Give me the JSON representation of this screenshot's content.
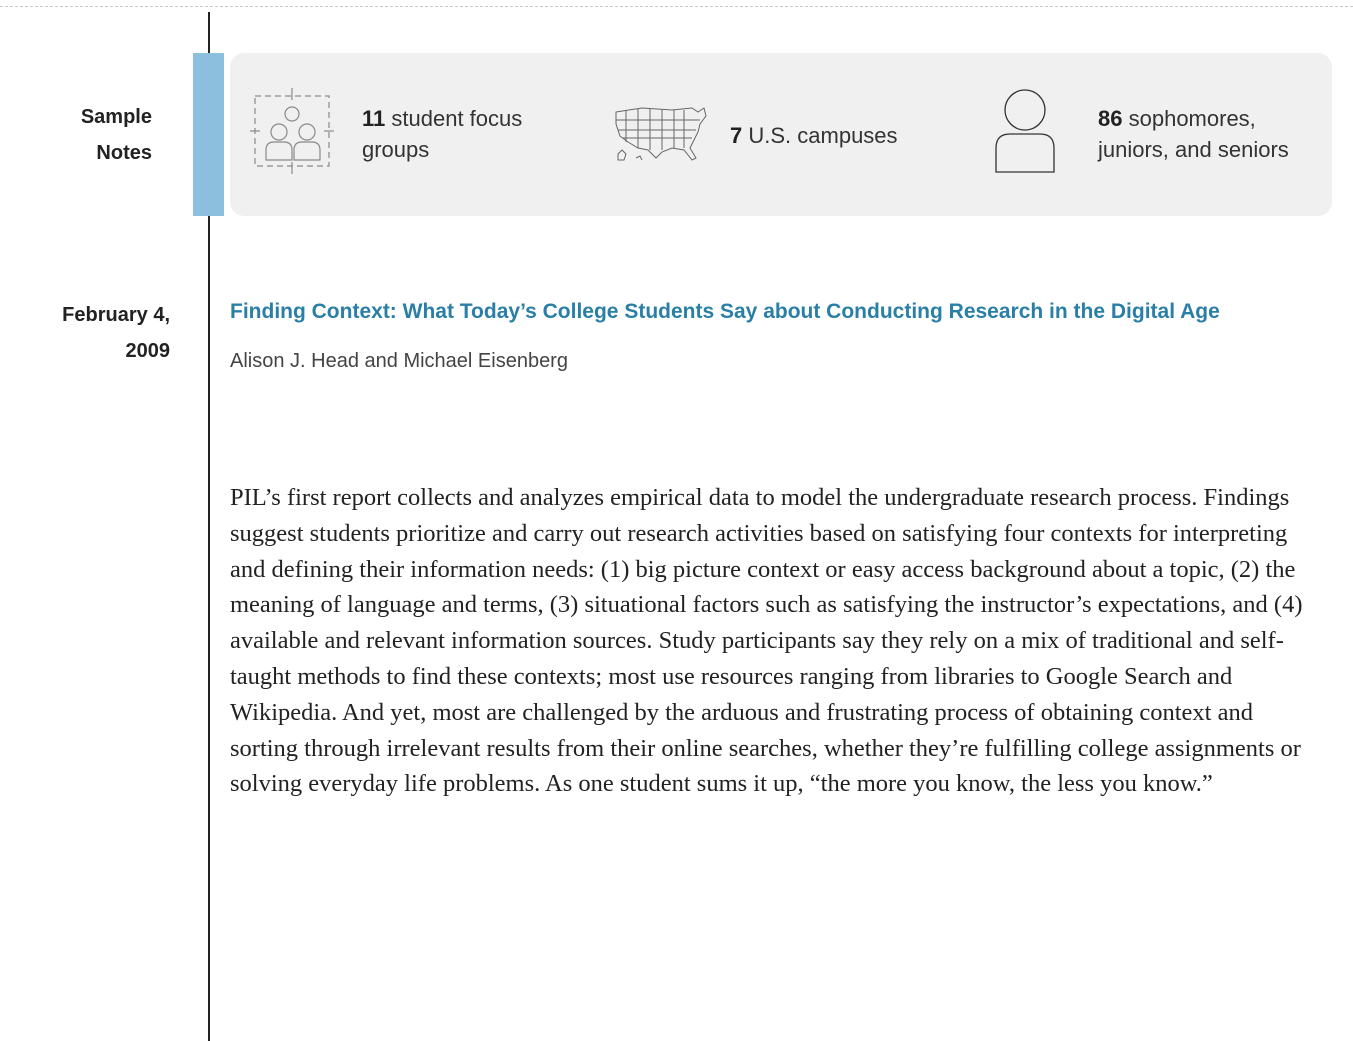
{
  "sample": {
    "label": "Sample Notes",
    "stats": [
      {
        "icon": "focus-group-icon",
        "number": "11",
        "text": "student focus groups"
      },
      {
        "icon": "us-map-icon",
        "number": "7",
        "text": "U.S. campuses"
      },
      {
        "icon": "person-icon",
        "number": "86",
        "text": "sophomores, juniors, and seniors"
      }
    ]
  },
  "report": {
    "date": "February 4, 2009",
    "title": "Finding Context: What Today’s College Students Say about Conducting Research in the Digital Age",
    "authors": "Alison J. Head and Michael Eisenberg",
    "summary": "PIL’s first report collects and analyzes empirical data to model the undergraduate research process. Findings suggest students prioritize and carry out research activities based on satisfying four contexts for interpreting and defining their information needs: (1) big picture context or easy access background about a topic, (2) the meaning of language and terms, (3) situational factors such as satisfying the instructor’s expectations, and (4) available and relevant information sources. Study participants say they rely on a mix of traditional and self-taught methods to find these contexts; most use resources ranging from libraries to Google Search and Wikipedia. And yet, most are challenged by the arduous and frustrating process of obtaining context and sorting through irrelevant results from their online searches, whether they’re fulfilling college assignments or solving everyday life problems. As one student sums it up, “the more you know, the less you know.”"
  },
  "colors": {
    "accent": "#8cbfde",
    "title": "#2a7fa6",
    "panel": "#f0f0f0"
  }
}
